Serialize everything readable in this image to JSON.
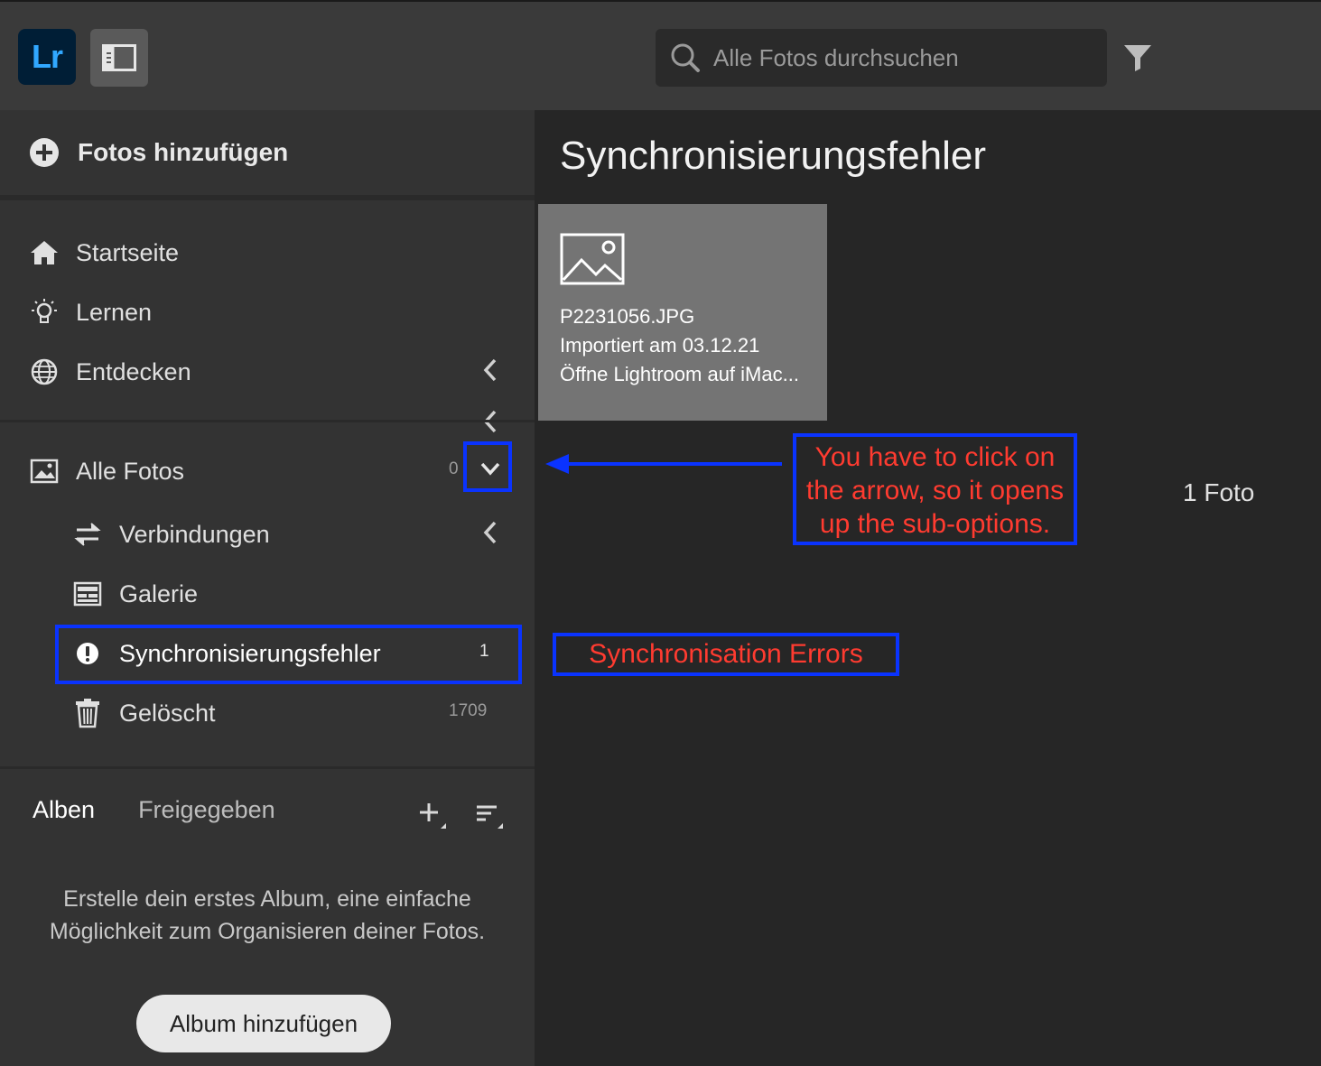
{
  "app": {
    "logo_text": "Lr",
    "brand_color": "#31a8ff"
  },
  "toolbar": {
    "search_placeholder": "Alle Fotos durchsuchen"
  },
  "sidebar": {
    "add_photos": "Fotos hinzufügen",
    "nav": [
      {
        "label": "Startseite",
        "icon": "home-icon"
      },
      {
        "label": "Lernen",
        "icon": "lightbulb-icon"
      },
      {
        "label": "Entdecken",
        "icon": "globe-icon"
      }
    ],
    "library": {
      "all_photos": {
        "label": "Alle Fotos",
        "count": "0"
      },
      "items": [
        {
          "label": "Verbindungen",
          "count": ""
        },
        {
          "label": "Galerie",
          "count": ""
        },
        {
          "label": "Synchronisierungsfehler",
          "count": "1"
        },
        {
          "label": "Gelöscht",
          "count": "1709"
        }
      ]
    },
    "albums": {
      "tab_albums": "Alben",
      "tab_shared": "Freigegeben",
      "empty_line1": "Erstelle dein erstes Album, eine einfache",
      "empty_line2": "Möglichkeit zum Organisieren deiner Fotos.",
      "add_button": "Album hinzufügen"
    }
  },
  "main": {
    "title": "Synchronisierungsfehler",
    "photo": {
      "filename": "P2231056.JPG",
      "imported": "Importiert am 03.12.21",
      "hint": "Öffne Lightroom auf iMac..."
    },
    "photo_count": "1 Foto"
  },
  "annotations": {
    "arrow_note_line1": "You have to click on",
    "arrow_note_line2": "the arrow, so it opens",
    "arrow_note_line3": "up the sub-options.",
    "sync_note": "Synchronisation Errors",
    "box_color": "#0a33ff",
    "text_color": "#ff3b30"
  }
}
